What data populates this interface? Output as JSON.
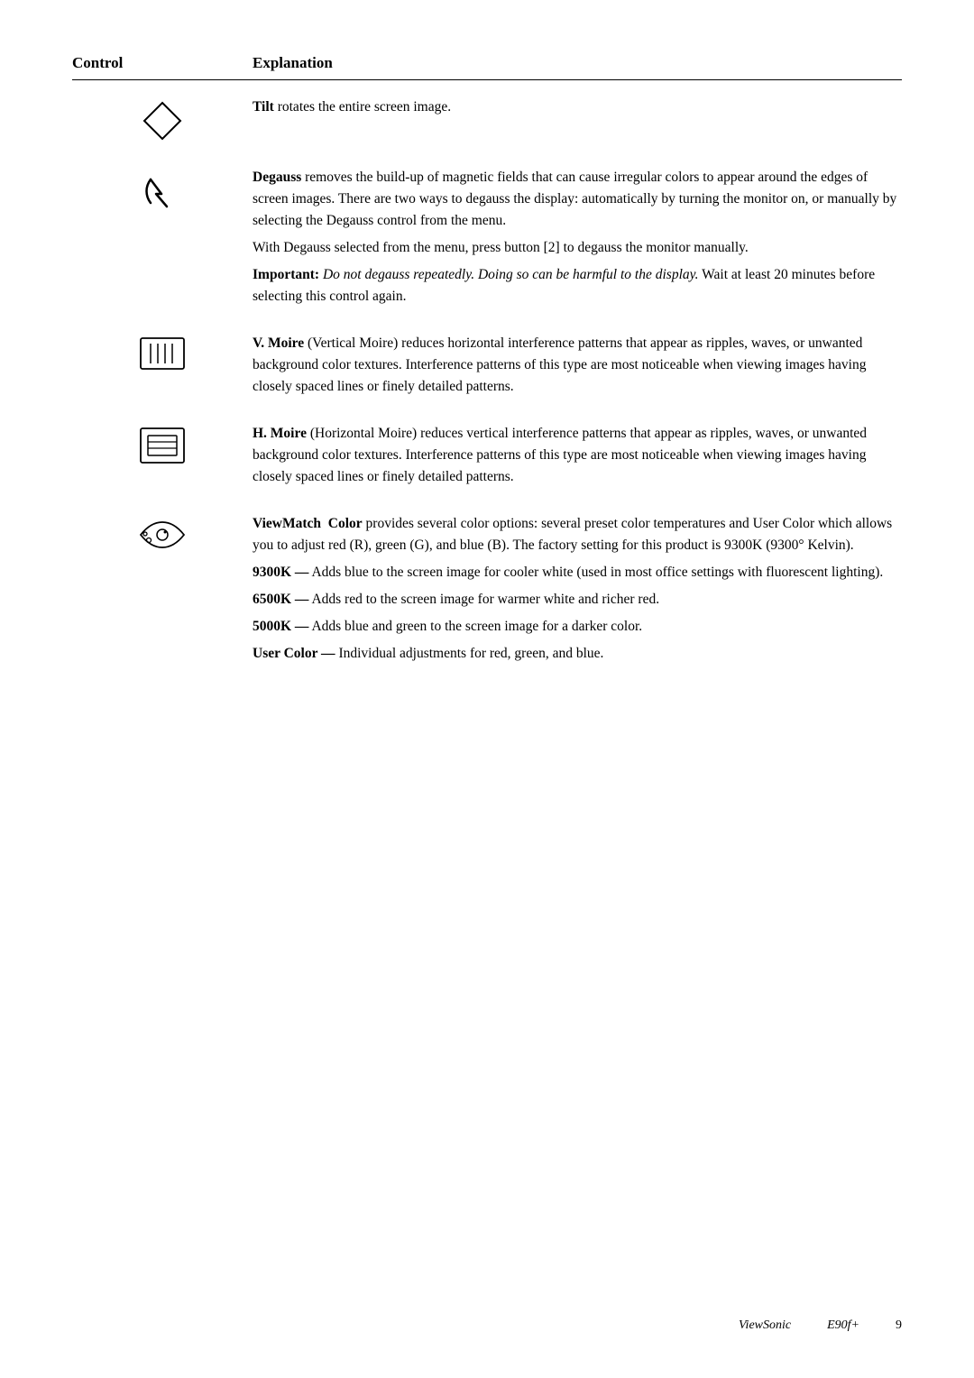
{
  "header": {
    "control_label": "Control",
    "explanation_label": "Explanation"
  },
  "rows": [
    {
      "id": "tilt",
      "icon": "tilt-icon",
      "text_html": "<p><span class='bold-term'>Tilt</span> rotates the entire screen image.</p>"
    },
    {
      "id": "degauss",
      "icon": "degauss-icon",
      "text_html": "<p><span class='bold-term'>Degauss</span> removes the build-up of magnetic fields that can cause irregular colors to appear around the edges of screen images. There are two ways to degauss the display: automatically by turning the monitor on, or manually by selecting the Degauss control from the menu.</p><p>With Degauss selected from the menu, press button [2] to degauss the monitor manually.</p><p><span class='bold-term'>Important:</span> <span class='italic-text'>Do not degauss repeatedly. Doing so can be harmful to the display.</span> Wait at least 20 minutes before selecting this control again.</p>"
    },
    {
      "id": "vmoire",
      "icon": "vmoire-icon",
      "text_html": "<p><span class='bold-term'>V. Moire</span> (Vertical Moire) reduces horizontal interference patterns that appear as ripples, waves, or unwanted background color textures. Interference patterns of this type are most noticeable when viewing images having closely spaced lines or finely detailed patterns.</p>"
    },
    {
      "id": "hmoire",
      "icon": "hmoire-icon",
      "text_html": "<p><span class='bold-term'>H. Moire</span> (Horizontal Moire) reduces vertical interference patterns that appear as ripples, waves, or unwanted background color textures. Interference patterns of this type are most noticeable when viewing images having closely spaced lines or finely detailed patterns.</p>"
    },
    {
      "id": "viewmatch",
      "icon": "viewmatch-icon",
      "text_html": "<p><span class='bold-term'>ViewMatch&nbsp;&nbsp;Color</span> provides several color options: several preset color temperatures and User Color which allows you to adjust red (R), green (G), and blue (B). The factory setting for this product is 9300K (9300° Kelvin).</p><p><span class='bold-term'>9300K —</span> Adds blue to the screen image for cooler white (used in most office settings with fluorescent lighting).</p><p><span class='bold-term'>6500K —</span> Adds red to the screen image for warmer white and richer red.</p><p><span class='bold-term'>5000K —</span> Adds blue and green to the screen image for a darker color.</p><p><span class='bold-term'>User Color —</span> Individual adjustments for red, green, and blue.</p>"
    }
  ],
  "footer": {
    "brand": "ViewSonic",
    "model": "E90f+",
    "page": "9"
  }
}
